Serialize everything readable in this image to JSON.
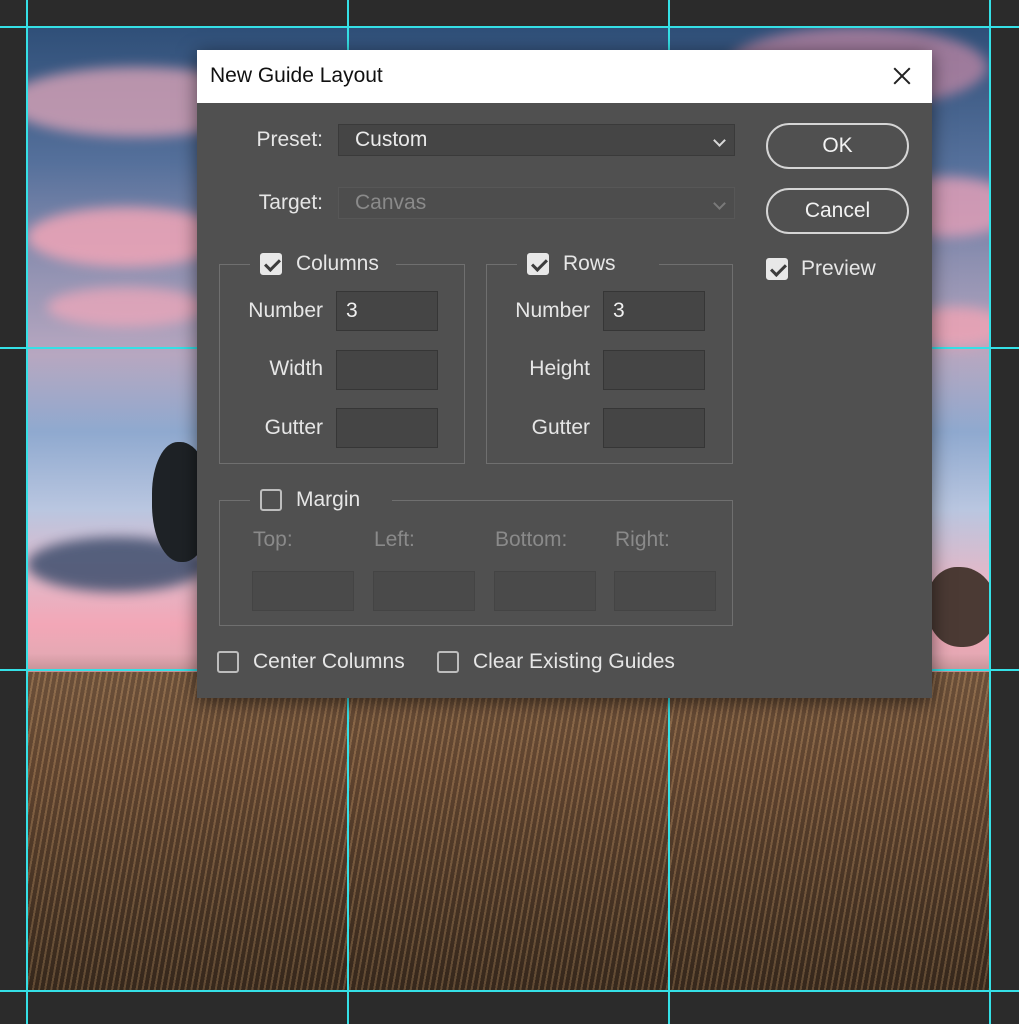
{
  "dialog": {
    "title": "New Guide Layout",
    "preset_label": "Preset:",
    "preset_value": "Custom",
    "target_label": "Target:",
    "target_value": "Canvas",
    "ok_label": "OK",
    "cancel_label": "Cancel",
    "preview_label": "Preview",
    "preview_checked": true
  },
  "columns": {
    "label": "Columns",
    "checked": true,
    "number_label": "Number",
    "number_value": "3",
    "width_label": "Width",
    "width_value": "",
    "gutter_label": "Gutter",
    "gutter_value": ""
  },
  "rows": {
    "label": "Rows",
    "checked": true,
    "number_label": "Number",
    "number_value": "3",
    "height_label": "Height",
    "height_value": "",
    "gutter_label": "Gutter",
    "gutter_value": ""
  },
  "margin": {
    "label": "Margin",
    "checked": false,
    "top_label": "Top:",
    "left_label": "Left:",
    "bottom_label": "Bottom:",
    "right_label": "Right:"
  },
  "options": {
    "center_columns_label": "Center Columns",
    "center_columns_checked": false,
    "clear_guides_label": "Clear Existing Guides",
    "clear_guides_checked": false
  },
  "colors": {
    "guide": "#35e0e6",
    "dialog_bg": "#505050",
    "workspace_bg": "#2b2b2b"
  }
}
